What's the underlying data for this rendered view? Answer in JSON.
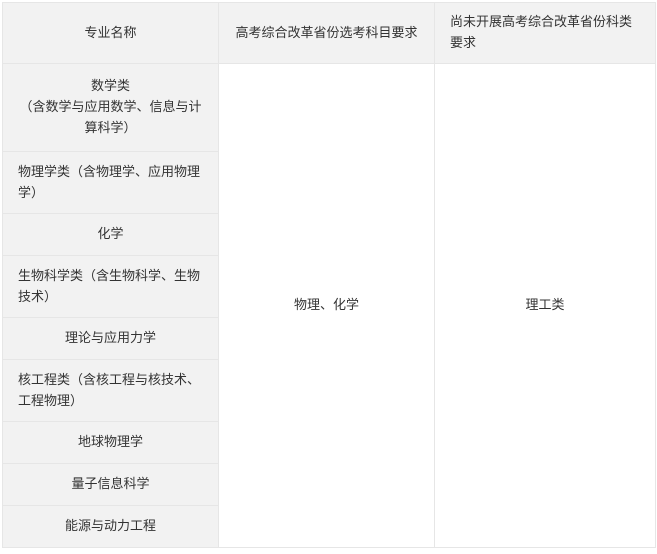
{
  "table": {
    "headers": [
      "专业名称",
      "高考综合改革省份选考科目要求",
      "尚未开展高考综合改革省份科类要求"
    ],
    "majors": [
      {
        "lines": [
          "数学类",
          "（含数学与应用数学、信息与计算科学）"
        ]
      },
      {
        "lines": [
          "物理学类（含物理学、应用物理学）"
        ]
      },
      {
        "lines": [
          "化学"
        ]
      },
      {
        "lines": [
          "生物科学类（含生物科学、生物技术）"
        ]
      },
      {
        "lines": [
          "理论与应用力学"
        ]
      },
      {
        "lines": [
          "核工程类（含核工程与核技术、工程物理）"
        ]
      },
      {
        "lines": [
          "地球物理学"
        ]
      },
      {
        "lines": [
          "量子信息科学"
        ]
      },
      {
        "lines": [
          "能源与动力工程"
        ]
      }
    ],
    "subject_requirement": "物理、化学",
    "category_requirement": "理工类"
  }
}
